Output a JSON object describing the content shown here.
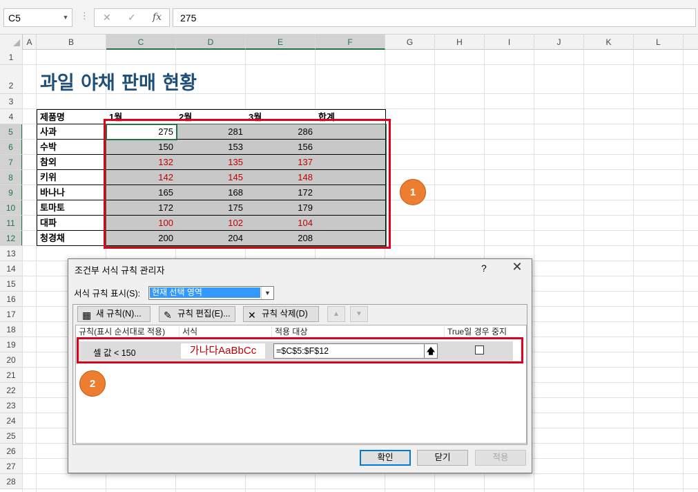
{
  "formula_bar": {
    "name_box": "C5",
    "cancel_icon": "✕",
    "enter_icon": "✓",
    "fx_icon": "fx",
    "formula": "275"
  },
  "columns": [
    "A",
    "B",
    "C",
    "D",
    "E",
    "F",
    "G",
    "H",
    "I",
    "J",
    "K",
    "L"
  ],
  "rows": [
    "1",
    "2",
    "3",
    "4",
    "5",
    "6",
    "7",
    "8",
    "9",
    "10",
    "11",
    "12",
    "13",
    "14",
    "15",
    "16",
    "17",
    "18",
    "19",
    "20",
    "21",
    "22",
    "23",
    "24",
    "25",
    "26",
    "27",
    "28"
  ],
  "sheet": {
    "title": "과일 야채 판매 현황",
    "headers": [
      "제품명",
      "1월",
      "2월",
      "3월",
      "합계"
    ],
    "items": [
      {
        "name": "사과",
        "values": [
          "275",
          "281",
          "286"
        ],
        "red": false
      },
      {
        "name": "수박",
        "values": [
          "150",
          "153",
          "156"
        ],
        "red": false
      },
      {
        "name": "참외",
        "values": [
          "132",
          "135",
          "137"
        ],
        "red": true
      },
      {
        "name": "키위",
        "values": [
          "142",
          "145",
          "148"
        ],
        "red": true
      },
      {
        "name": "바나나",
        "values": [
          "165",
          "168",
          "172"
        ],
        "red": false
      },
      {
        "name": "토마토",
        "values": [
          "172",
          "175",
          "179"
        ],
        "red": false
      },
      {
        "name": "대파",
        "values": [
          "100",
          "102",
          "104"
        ],
        "red": true
      },
      {
        "name": "청경채",
        "values": [
          "200",
          "204",
          "208"
        ],
        "red": false
      }
    ]
  },
  "badges": {
    "one": "1",
    "two": "2"
  },
  "dialog": {
    "title": "조건부 서식 규칙 관리자",
    "help": "?",
    "close": "✕",
    "show_label": "서식 규칙 표시(S):",
    "show_value": "현재 선택 영역",
    "buttons": {
      "new_rule": "새 규칙(N)...",
      "edit_rule": "규칙 편집(E)...",
      "delete_rule": "규칙 삭제(D)",
      "up": "▲",
      "down": "▼"
    },
    "list_headers": {
      "rule": "규칙(표시 순서대로 적용)",
      "format": "서식",
      "applies_to": "적용 대상",
      "stop_if_true": "True일 경우 중지"
    },
    "rule": {
      "condition": "셀 값 < 150",
      "preview": "가나다AaBbCc",
      "range": "=$C$5:$F$12",
      "range_btn": "🡅"
    },
    "footer": {
      "ok": "확인",
      "close": "닫기",
      "apply": "적용"
    }
  },
  "colors": {
    "accent_red": "#e0001b",
    "badge": "#ed7d31",
    "title_blue": "#1f4e79",
    "value_red": "#c00000",
    "excel_green": "#217346"
  }
}
